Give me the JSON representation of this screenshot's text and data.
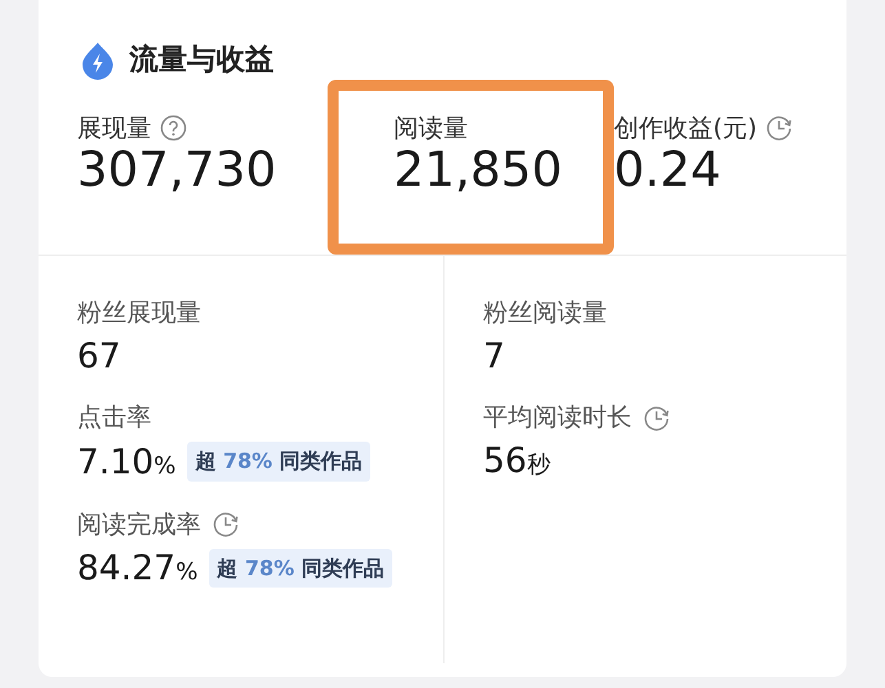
{
  "section": {
    "title": "流量与收益"
  },
  "top_metrics": [
    {
      "label": "展现量",
      "kind": "help",
      "value": "307,730",
      "highlighted": false
    },
    {
      "label": "阅读量",
      "value": "21,850",
      "highlighted": true
    },
    {
      "label": "创作收益(元)",
      "kind": "timed",
      "value": "0.24",
      "highlighted": false
    }
  ],
  "detail_columns": [
    [
      {
        "label": "粉丝展现量",
        "value": "67"
      },
      {
        "label": "点击率",
        "value": "7.10",
        "unit": "%",
        "badge": {
          "prefix": "超",
          "percent": "78%",
          "suffix": "同类作品"
        }
      },
      {
        "label": "阅读完成率",
        "kind": "timed",
        "value": "84.27",
        "unit": "%",
        "badge": {
          "prefix": "超",
          "percent": "78%",
          "suffix": "同类作品"
        }
      }
    ],
    [
      {
        "label": "粉丝阅读量",
        "value": "7"
      },
      {
        "label": "平均阅读时长",
        "kind": "timed",
        "value": "56",
        "unit": "秒"
      }
    ]
  ]
}
